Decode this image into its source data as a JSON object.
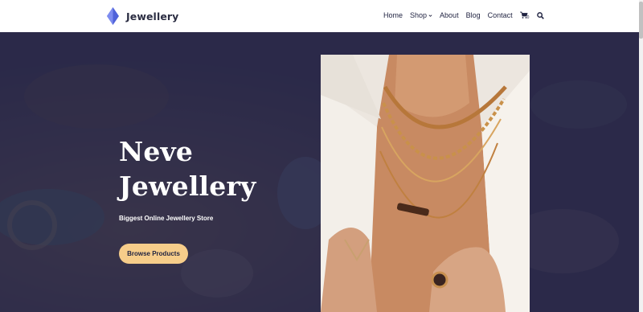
{
  "site": {
    "name": "Jewellery",
    "brand_color": "#4f62d9"
  },
  "nav": {
    "items": [
      {
        "label": "Home"
      },
      {
        "label": "Shop",
        "has_dropdown": true
      },
      {
        "label": "About"
      },
      {
        "label": "Blog"
      },
      {
        "label": "Contact"
      }
    ],
    "cart_count": "0",
    "icons": [
      "cart-icon",
      "search-icon"
    ]
  },
  "hero": {
    "title": "Neve Jewellery",
    "subtitle": "Biggest Online Jewellery Store",
    "cta_label": "Browse Products",
    "cta_color": "#f6cd8a",
    "overlay_color": "#262646"
  }
}
